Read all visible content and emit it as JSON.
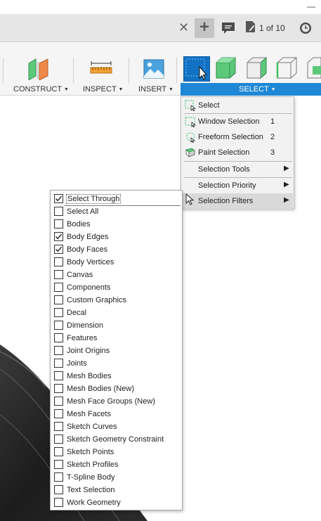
{
  "window": {
    "minimize_glyph": "—"
  },
  "tabbar": {
    "close_glyph": "✕",
    "new_tab_glyph": "+",
    "page_indicator": "1 of 10"
  },
  "toolbar": {
    "groups": [
      {
        "label": "CONSTRUCT",
        "icon": "construct-plane-icon"
      },
      {
        "label": "INSPECT",
        "icon": "measure-ruler-icon"
      },
      {
        "label": "INSERT",
        "icon": "insert-image-icon"
      },
      {
        "label": "SELECT",
        "icon": "select-arrow-icon"
      }
    ],
    "caret": "▼"
  },
  "select_menu": {
    "items": [
      {
        "label": "Select",
        "shortcut": "",
        "icon": "select-box-icon",
        "submenu": false
      },
      {
        "label": "Window Selection",
        "shortcut": "1",
        "icon": "window-selection-icon",
        "submenu": false
      },
      {
        "label": "Freeform Selection",
        "shortcut": "2",
        "icon": "freeform-selection-icon",
        "submenu": false
      },
      {
        "label": "Paint Selection",
        "shortcut": "3",
        "icon": "paint-selection-icon",
        "submenu": false
      },
      {
        "label": "Selection Tools",
        "shortcut": "",
        "icon": "",
        "submenu": true
      },
      {
        "label": "Selection Priority",
        "shortcut": "",
        "icon": "",
        "submenu": true
      },
      {
        "label": "Selection Filters",
        "shortcut": "",
        "icon": "",
        "submenu": true,
        "highlighted": true
      }
    ],
    "arrow": "▶"
  },
  "selection_filters": {
    "items": [
      {
        "label": "Select Through",
        "checked": true
      },
      {
        "label": "Select All",
        "checked": false
      },
      {
        "label": "Bodies",
        "checked": false
      },
      {
        "label": "Body Edges",
        "checked": true
      },
      {
        "label": "Body Faces",
        "checked": true
      },
      {
        "label": "Body Vertices",
        "checked": false
      },
      {
        "label": "Canvas",
        "checked": false
      },
      {
        "label": "Components",
        "checked": false
      },
      {
        "label": "Custom Graphics",
        "checked": false
      },
      {
        "label": "Decal",
        "checked": false
      },
      {
        "label": "Dimension",
        "checked": false
      },
      {
        "label": "Features",
        "checked": false
      },
      {
        "label": "Joint Origins",
        "checked": false
      },
      {
        "label": "Joints",
        "checked": false
      },
      {
        "label": "Mesh Bodies",
        "checked": false
      },
      {
        "label": "Mesh Bodies (New)",
        "checked": false
      },
      {
        "label": "Mesh Face Groups (New)",
        "checked": false
      },
      {
        "label": "Mesh Facets",
        "checked": false
      },
      {
        "label": "Sketch Curves",
        "checked": false
      },
      {
        "label": "Sketch Geometry Constraint",
        "checked": false
      },
      {
        "label": "Sketch Points",
        "checked": false
      },
      {
        "label": "Sketch Profiles",
        "checked": false
      },
      {
        "label": "T-Spline Body",
        "checked": false
      },
      {
        "label": "Text Selection",
        "checked": false
      },
      {
        "label": "Work Geometry",
        "checked": false
      }
    ]
  },
  "colors": {
    "accent": "#1e88d6",
    "select_button": "#1272c4",
    "cube_green": "#5cc97a",
    "menu_highlight": "#d9d9d9"
  }
}
